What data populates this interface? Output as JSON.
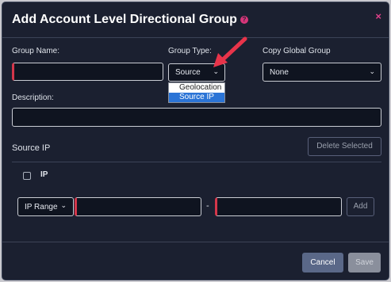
{
  "modal": {
    "title": "Add Account Level Directional Group",
    "help_icon": "?",
    "close_icon": "×"
  },
  "form": {
    "group_name_label": "Group Name:",
    "group_name_value": "",
    "group_type_label": "Group Type:",
    "group_type_value": "Source",
    "group_type_options": [
      "Geolocation",
      "Source IP"
    ],
    "group_type_highlighted": "Source IP",
    "copy_global_label": "Copy Global Group",
    "copy_global_value": "None",
    "description_label": "Description:",
    "description_value": ""
  },
  "source_ip": {
    "section_title": "Source IP",
    "delete_selected": "Delete Selected",
    "column_ip": "IP",
    "range_type": "IP Range",
    "separator": "-",
    "add_label": "Add"
  },
  "footer": {
    "cancel": "Cancel",
    "save": "Save"
  },
  "colors": {
    "background": "#1b2030",
    "accent_pink": "#d9367a",
    "required_red": "#d4364a",
    "cancel_button": "#5a6888",
    "highlight_blue": "#2b74d6"
  }
}
